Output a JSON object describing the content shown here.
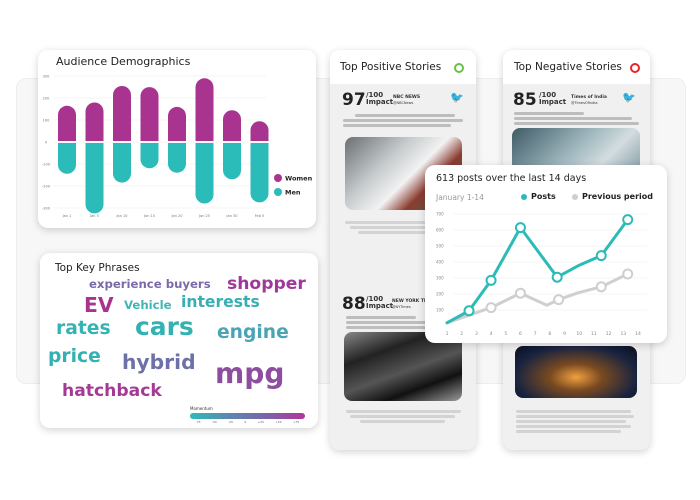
{
  "demographics": {
    "title": "Audience Demographics",
    "chart_data": {
      "type": "bar",
      "categories": [
        "Jan 1",
        "Jan 5",
        "Jan 10",
        "Jan 15",
        "Jan 20",
        "Jan 25",
        "Jan 30",
        "Feb 5"
      ],
      "series": [
        {
          "name": "Women",
          "color": "#a8348f",
          "values": [
            160,
            175,
            250,
            245,
            155,
            285,
            140,
            90
          ]
        },
        {
          "name": "Men",
          "color": "#2bbbb8",
          "values": [
            -140,
            -320,
            -180,
            -115,
            -135,
            -275,
            -165,
            -270
          ]
        }
      ],
      "yticks": [
        "300",
        "200",
        "100",
        "0",
        "-100",
        "-200",
        "-300"
      ],
      "ylim": [
        -300,
        300
      ],
      "legend": "right",
      "grid": true
    }
  },
  "key_phrases": {
    "title": "Top Key Phrases",
    "words": [
      {
        "text": "experience buyers",
        "color": "#7b6aa8"
      },
      {
        "text": "shopper",
        "color": "#a0389a"
      },
      {
        "text": "EV",
        "color": "#a8348f"
      },
      {
        "text": "Vehicle",
        "color": "#3fb6b5"
      },
      {
        "text": "interests",
        "color": "#3aaeb2"
      },
      {
        "text": "rates",
        "color": "#33b3b3"
      },
      {
        "text": "cars",
        "color": "#34b2b3"
      },
      {
        "text": "engine",
        "color": "#4aa4b3"
      },
      {
        "text": "price",
        "color": "#33b0b3"
      },
      {
        "text": "hybrid",
        "color": "#6e70a8"
      },
      {
        "text": "mpg",
        "color": "#8d4e9f"
      },
      {
        "text": "hatchback",
        "color": "#a43a94"
      }
    ],
    "momentum": {
      "label": "Momentum",
      "ticks": [
        "-75",
        "-50",
        "-25",
        "0",
        "+25",
        "+50",
        "+75"
      ]
    }
  },
  "positive": {
    "title": "Top Positive Stories",
    "indicator_color": "#6cc04a",
    "stories": [
      {
        "score": "97",
        "per": "/100",
        "impact": "Impact",
        "source": "NBC NEWS",
        "handle": "@NBCNews",
        "icon": "twitter-icon"
      },
      {
        "score": "88",
        "per": "/100",
        "impact": "Impact",
        "source": "NEW YORK TIMES",
        "handle": "@NYTimes"
      }
    ]
  },
  "negative": {
    "title": "Top Negative Stories",
    "indicator_color": "#e8262b",
    "stories": [
      {
        "score": "85",
        "per": "/100",
        "impact": "Impact",
        "source": "Times of India",
        "handle": "@TimesOfIndia",
        "icon": "twitter-icon"
      }
    ]
  },
  "posts": {
    "title": "613 posts over the last 14 days",
    "range": "January 1-14",
    "chart_data": {
      "type": "line",
      "x_ticks": [
        "1",
        "2",
        "3",
        "4",
        "5",
        "6",
        "7",
        "8",
        "9",
        "10",
        "11",
        "12",
        "13",
        "14"
      ],
      "y_ticks": [
        "700",
        "600",
        "500",
        "400",
        "300",
        "200",
        "100"
      ],
      "ylim": [
        0,
        700
      ],
      "xlim": [
        1,
        14
      ],
      "legend": "top",
      "grid": true,
      "series": [
        {
          "name": "Posts",
          "color": "#2bbbb8",
          "points": [
            [
              1,
              20
            ],
            [
              2.5,
              95
            ],
            [
              4,
              285
            ],
            [
              6,
              615
            ],
            [
              8.5,
              305
            ],
            [
              10,
              380
            ],
            [
              11.5,
              440
            ],
            [
              13.3,
              665
            ]
          ],
          "markers": [
            1,
            2,
            3,
            4,
            6,
            7
          ]
        },
        {
          "name": "Previous period",
          "color": "#cfcfcf",
          "points": [
            [
              1,
              20
            ],
            [
              4,
              115
            ],
            [
              6,
              205
            ],
            [
              7.8,
              130
            ],
            [
              8.6,
              165
            ],
            [
              10,
              210
            ],
            [
              11.5,
              245
            ],
            [
              13.3,
              325
            ]
          ],
          "markers": [
            1,
            2,
            4,
            6,
            7
          ]
        }
      ]
    }
  }
}
